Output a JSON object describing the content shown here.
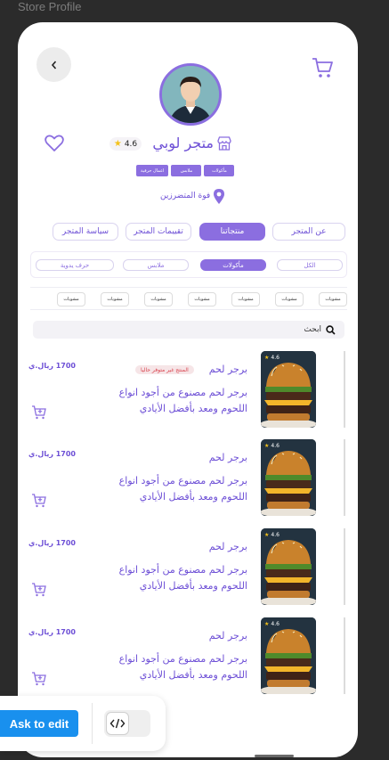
{
  "canvas": {
    "label": "Store Profile"
  },
  "header": {
    "back_icon": "chevron-left-icon",
    "cart_icon": "cart-icon"
  },
  "store": {
    "name": "متجر لوبي",
    "rating": "4.6",
    "tags": [
      "مأكولات",
      "ملابس",
      "اعمال حرفية"
    ],
    "location": "فوة المتضرزين"
  },
  "main_tabs": [
    {
      "label": "عن المتجر",
      "active": false
    },
    {
      "label": "منتجاتنا",
      "active": true
    },
    {
      "label": "تقييمات المتجر",
      "active": false
    },
    {
      "label": "سياسة المتجر",
      "active": false
    }
  ],
  "categories": [
    {
      "label": "الكل",
      "active": false
    },
    {
      "label": "مأكولات",
      "active": true
    },
    {
      "label": "ملابس",
      "active": false
    },
    {
      "label": "حرف يدوية",
      "active": false
    }
  ],
  "subcategories": [
    "مشويات",
    "مشويات",
    "مشويات",
    "مشويات",
    "مشويات",
    "مشويات",
    "مشويات"
  ],
  "search": {
    "placeholder": "ابحث"
  },
  "products": [
    {
      "name": "برجر لحم",
      "description": "برجر لحم مصنوع من أجود انواع اللحوم ومعد بأفضل الأيادي",
      "price": "1700 ريال.ي",
      "rating": "4.6",
      "status": "المنتج غير متوفر حاليا"
    },
    {
      "name": "برجر لحم",
      "description": "برجر لحم مصنوع من أجود انواع اللحوم ومعد بأفضل الأيادي",
      "price": "1700 ريال.ي",
      "rating": "4.6",
      "status": ""
    },
    {
      "name": "برجر لحم",
      "description": "برجر لحم مصنوع من أجود انواع اللحوم ومعد بأفضل الأيادي",
      "price": "1700 ريال.ي",
      "rating": "4.6",
      "status": ""
    },
    {
      "name": "برجر لحم",
      "description": "برجر لحم مصنوع من أجود انواع اللحوم ومعد بأفضل الأيادي",
      "price": "1700 ريال.ي",
      "rating": "4.6",
      "status": ""
    }
  ],
  "edit_bar": {
    "ask_label": "Ask to edit",
    "code_icon": "code-icon"
  },
  "colors": {
    "accent": "#8b6ee0",
    "text_accent": "#6d4fd6",
    "ask_blue": "#1990ee"
  }
}
